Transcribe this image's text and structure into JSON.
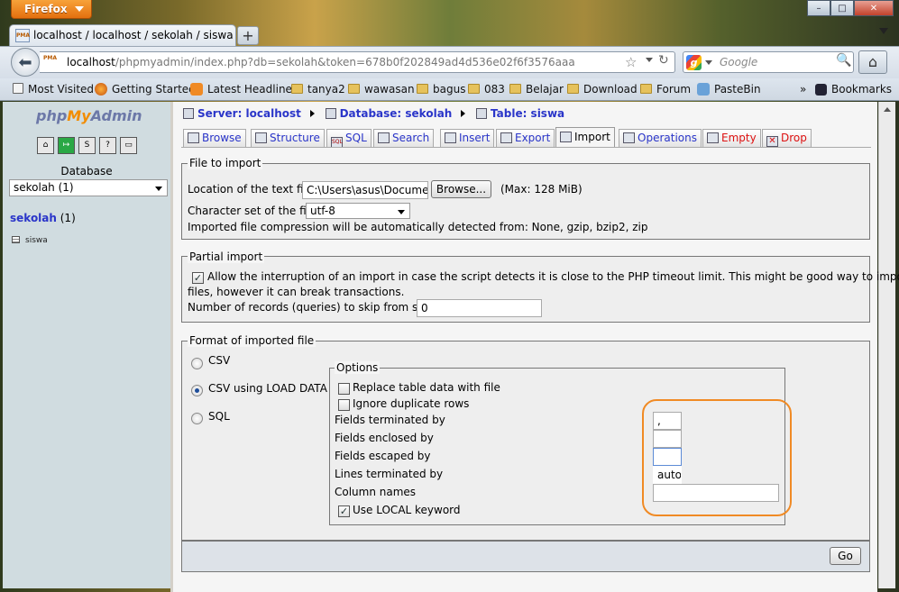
{
  "browser": {
    "menu_button": "Firefox",
    "tab_title": "localhost / localhost / sekolah / siswa | p...",
    "url_host": "localhost",
    "url_path": "/phpmyadmin/index.php?db=sekolah&token=678b0f202849ad4d536e02f6f3576aaa",
    "search_placeholder": "Google",
    "window_controls": [
      "–",
      "□",
      "✕"
    ],
    "bookmarks": [
      "Most Visited",
      "Getting Started",
      "Latest Headlines",
      "tanya2",
      "wawasan",
      "bagus",
      "083",
      "Belajar",
      "Download",
      "Forum",
      "PasteBin"
    ],
    "bookmarks_menu": "Bookmarks",
    "overflow": "»"
  },
  "nav": {
    "logo_php": "php",
    "logo_my": "My",
    "logo_admin": "Admin",
    "buttons": [
      "home-icon",
      "exit-icon",
      "sql-icon",
      "help-icon",
      "query-window-icon"
    ],
    "database_label": "Database",
    "database_select": "sekolah (1)",
    "db_name": "sekolah",
    "db_count": " (1)",
    "table": "siswa"
  },
  "breadcrumb": {
    "server": "Server: localhost",
    "database": "Database: sekolah",
    "table": "Table: siswa"
  },
  "tabs": [
    {
      "label": "Browse",
      "color": "#2a35c9"
    },
    {
      "label": "Structure",
      "color": "#2a35c9"
    },
    {
      "label": "SQL",
      "color": "#2a35c9"
    },
    {
      "label": "Search",
      "color": "#2a35c9"
    },
    {
      "label": "Insert",
      "color": "#2a35c9"
    },
    {
      "label": "Export",
      "color": "#2a35c9"
    },
    {
      "label": "Import",
      "active": true
    },
    {
      "label": "Operations",
      "color": "#2a35c9"
    },
    {
      "label": "Empty",
      "color": "#dd1111"
    },
    {
      "label": "Drop",
      "color": "#dd1111"
    }
  ],
  "file_import": {
    "legend": "File to import",
    "location_label": "Location of the text file",
    "location_value": "C:\\Users\\asus\\Document",
    "browse_button": "Browse...",
    "max_size": "(Max: 128 MiB)",
    "charset_label": "Character set of the file:",
    "charset_value": "utf-8",
    "compression_note": "Imported file compression will be automatically detected from: None, gzip, bzip2, zip"
  },
  "partial_import": {
    "legend": "Partial import",
    "allow_interrupt_line1": "Allow the interruption of an import in case the script detects it is close to the PHP timeout limit. This might be good way to import large",
    "allow_interrupt_line2": "files, however it can break transactions.",
    "allow_interrupt_checked": true,
    "skip_label": "Number of records (queries) to skip from start",
    "skip_value": "0"
  },
  "format": {
    "legend": "Format of imported file",
    "options": [
      "CSV",
      "CSV using LOAD DATA",
      "SQL"
    ],
    "selected": "CSV using LOAD DATA",
    "options_legend": "Options",
    "replace_label": "Replace table data with file",
    "replace_checked": false,
    "ignore_label": "Ignore duplicate rows",
    "ignore_checked": false,
    "fields_terminated_label": "Fields terminated by",
    "fields_terminated_value": ",",
    "fields_enclosed_label": "Fields enclosed by",
    "fields_enclosed_value": "",
    "fields_escaped_label": "Fields escaped by",
    "fields_escaped_value": "",
    "lines_terminated_label": "Lines terminated by",
    "lines_terminated_value": "auto",
    "column_names_label": "Column names",
    "column_names_value": "",
    "use_local_label": "Use LOCAL keyword",
    "use_local_checked": true
  },
  "footer": {
    "go_button": "Go"
  }
}
